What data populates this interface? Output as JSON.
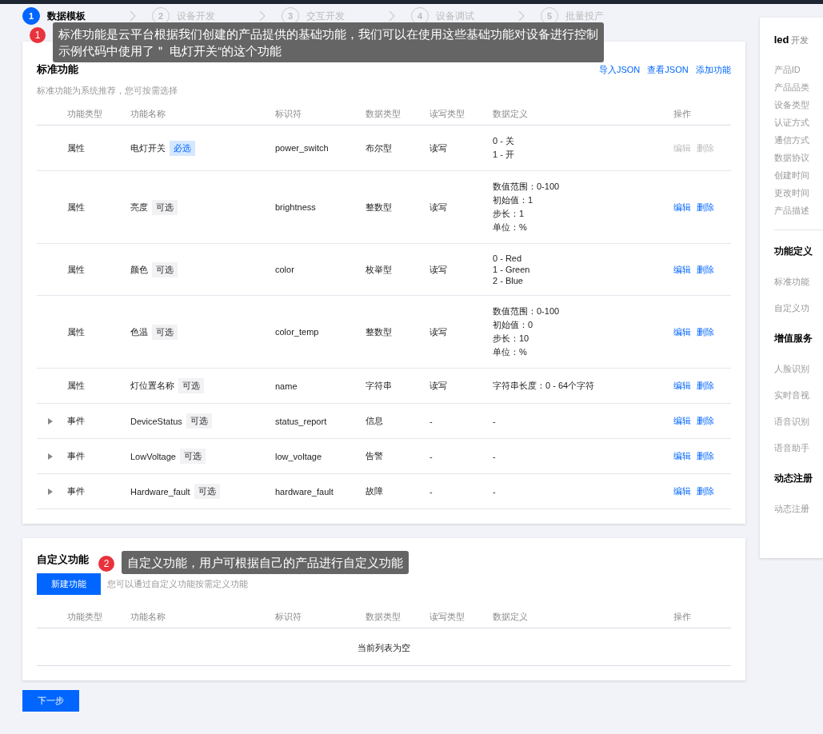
{
  "steps": [
    {
      "number": "1",
      "label": "数据模板",
      "selected": true
    },
    {
      "number": "2",
      "label": "设备开发",
      "selected": false
    },
    {
      "number": "3",
      "label": "交互开发",
      "selected": false
    },
    {
      "number": "4",
      "label": "设备调试",
      "selected": false
    },
    {
      "number": "5",
      "label": "批量投产",
      "selected": false
    }
  ],
  "callouts": [
    {
      "number": "1",
      "lines": [
        "标准功能是云平台根据我们创建的产品提供的基础功能，我们可以在使用这些基础功能对设备进行控制",
        "示例代码中使用了＂ 电灯开关“的这个功能"
      ]
    },
    {
      "number": "2",
      "lines": [
        "自定义功能，用户可根据自己的产品进行自定义功能"
      ]
    }
  ],
  "standard_features": {
    "title": "标准功能",
    "subtitle": "标准功能为系统推荐，您可按需选择",
    "actions": [
      "导入JSON",
      "查看JSON",
      "添加功能"
    ],
    "columns": [
      "功能类型",
      "功能名称",
      "标识符",
      "数据类型",
      "读写类型",
      "数据定义",
      "操作"
    ],
    "rows": [
      {
        "kind": "property",
        "type": "属性",
        "name": "电灯开关",
        "tag": "必选",
        "required": true,
        "identifier": "power_switch",
        "data_type": "布尔型",
        "access": "读写",
        "definition": [
          "0 - 关",
          "1 - 开"
        ],
        "edit": "编辑",
        "delete": "删除",
        "actions_disabled": true
      },
      {
        "kind": "property",
        "type": "属性",
        "name": "亮度",
        "tag": "可选",
        "required": false,
        "identifier": "brightness",
        "data_type": "整数型",
        "access": "读写",
        "definition": [
          "数值范围：0-100",
          "初始值：1",
          "步长：1",
          "单位：%"
        ],
        "edit": "编辑",
        "delete": "删除",
        "actions_disabled": false
      },
      {
        "kind": "property",
        "type": "属性",
        "name": "颜色",
        "tag": "可选",
        "required": false,
        "identifier": "color",
        "data_type": "枚举型",
        "access": "读写",
        "definition": [
          "0 - Red",
          "1 - Green",
          "2 - Blue"
        ],
        "edit": "编辑",
        "delete": "删除",
        "actions_disabled": false
      },
      {
        "kind": "property",
        "type": "属性",
        "name": "色温",
        "tag": "可选",
        "required": false,
        "identifier": "color_temp",
        "data_type": "整数型",
        "access": "读写",
        "definition": [
          "数值范围：0-100",
          "初始值：0",
          "步长：10",
          "单位：%"
        ],
        "edit": "编辑",
        "delete": "删除",
        "actions_disabled": false
      },
      {
        "kind": "property",
        "type": "属性",
        "name": "灯位置名称",
        "tag": "可选",
        "required": false,
        "identifier": "name",
        "data_type": "字符串",
        "access": "读写",
        "definition": [
          "字符串长度：0 - 64个字符"
        ],
        "edit": "编辑",
        "delete": "删除",
        "actions_disabled": false
      },
      {
        "kind": "event",
        "type": "事件",
        "name": "DeviceStatus",
        "tag": "可选",
        "required": false,
        "identifier": "status_report",
        "data_type": "信息",
        "access": "-",
        "definition": [
          "-"
        ],
        "edit": "编辑",
        "delete": "删除",
        "actions_disabled": false
      },
      {
        "kind": "event",
        "type": "事件",
        "name": "LowVoltage",
        "tag": "可选",
        "required": false,
        "identifier": "low_voltage",
        "data_type": "告警",
        "access": "-",
        "definition": [
          "-"
        ],
        "edit": "编辑",
        "delete": "删除",
        "actions_disabled": false
      },
      {
        "kind": "event",
        "type": "事件",
        "name": "Hardware_fault",
        "tag": "可选",
        "required": false,
        "identifier": "hardware_fault",
        "data_type": "故障",
        "access": "-",
        "definition": [
          "-"
        ],
        "edit": "编辑",
        "delete": "删除",
        "actions_disabled": false
      }
    ]
  },
  "custom_features": {
    "title": "自定义功能",
    "button": "新建功能",
    "hint": "您可以通过自定义功能按需定义功能",
    "columns": [
      "功能类型",
      "功能名称",
      "标识符",
      "数据类型",
      "读写类型",
      "数据定义",
      "操作"
    ],
    "empty": "当前列表为空"
  },
  "next_button": "下一步",
  "side_panel": {
    "name": "led",
    "status": "开发",
    "fields": [
      "产品ID",
      "产品品类",
      "设备类型",
      "认证方式",
      "通信方式",
      "数据协议",
      "创建时间",
      "更改时间",
      "产品描述"
    ],
    "sections": [
      {
        "title": "功能定义",
        "items": [
          "标准功能",
          "自定义功"
        ]
      },
      {
        "title": "增值服务",
        "items": [
          "人脸识别",
          "实时音视",
          "语音识别",
          "语音助手"
        ]
      },
      {
        "title": "动态注册",
        "items": [
          "动态注册"
        ]
      }
    ]
  }
}
